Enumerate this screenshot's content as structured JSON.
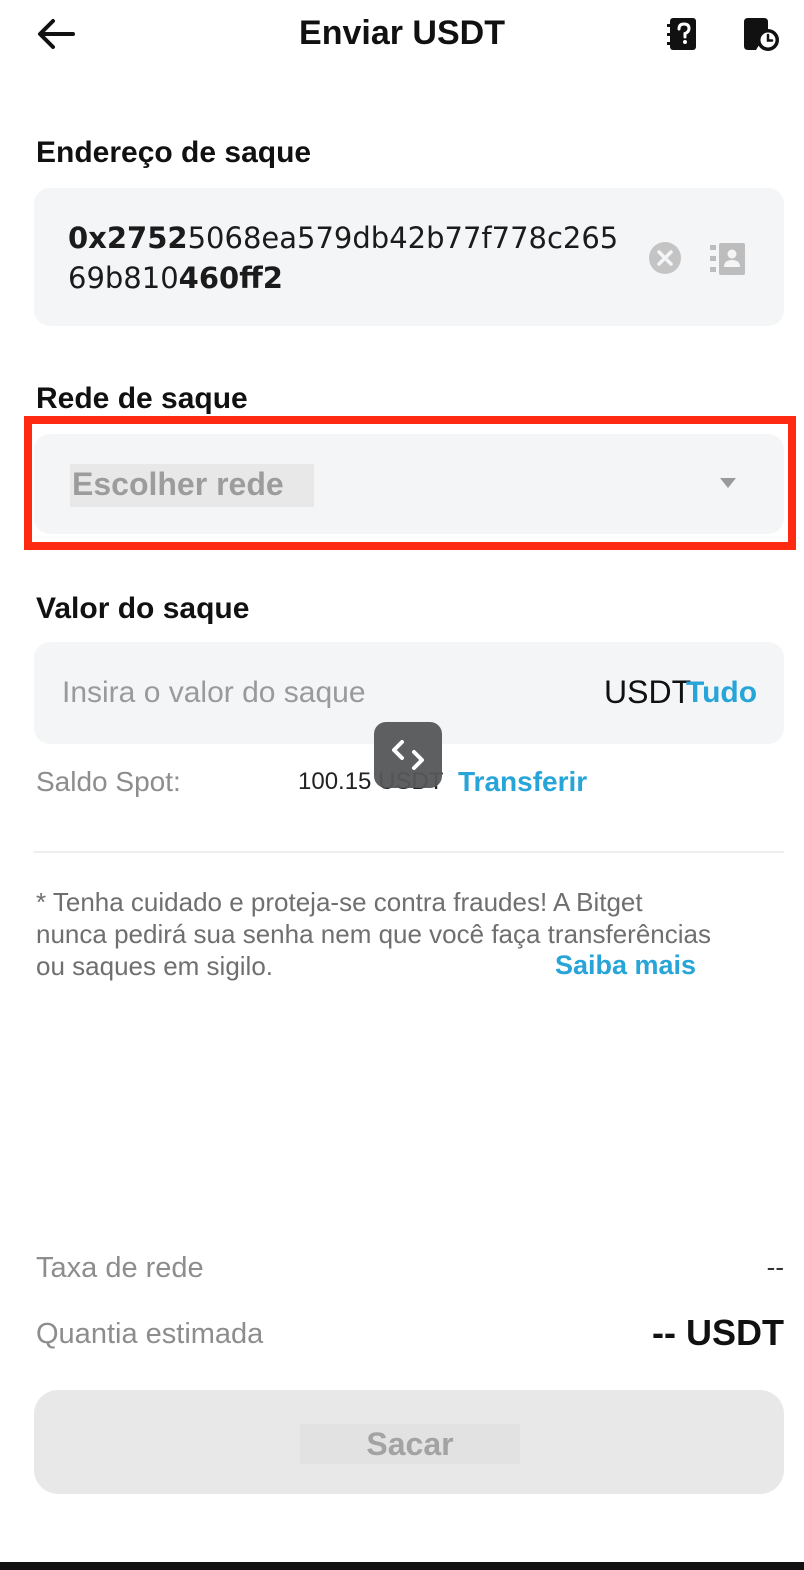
{
  "header": {
    "title": "Enviar USDT",
    "back_icon": "arrow-left-icon",
    "help_icon": "help-book-icon",
    "history_icon": "history-icon"
  },
  "address": {
    "label": "Endereço de saque",
    "value": "0x27525068ea579db42b77f778c26569b810460ff2",
    "value_line1_bold": "0x2752",
    "value_line1_rest": "5068ea579db42b77f778c265",
    "value_line2_rest": "69b810",
    "value_line2_bold": "460ff2",
    "clear_icon": "clear-circle-icon",
    "contacts_icon": "address-book-icon"
  },
  "network": {
    "label": "Rede de saque",
    "placeholder": "Escolher rede",
    "dropdown_icon": "caret-down-icon",
    "highlight_color": "#ff2a12"
  },
  "amount": {
    "label": "Valor do saque",
    "placeholder": "Insira o valor do saque",
    "value": "",
    "unit": "USDT",
    "all_label": "Tudo",
    "balance_label": "Saldo Spot:",
    "balance_value": "100.15 USDT",
    "transfer_label": "Transferir",
    "swap_icon": "swap-arrows-icon"
  },
  "warning": {
    "text": "* Tenha cuidado e proteja-se contra fraudes! A Bitget nunca pedirá sua senha nem que você faça transferências ou saques em sigilo.",
    "learn_more_label": "Saiba mais"
  },
  "summary": {
    "fee_label": "Taxa de rede",
    "fee_value": "--",
    "estimate_label": "Quantia estimada",
    "estimate_value": "-- USDT"
  },
  "submit": {
    "label": "Sacar"
  },
  "colors": {
    "accent": "#27a4d8",
    "field_bg": "#f4f5f6",
    "highlight": "#ff2a12",
    "disabled_button": "#e8e8e8"
  }
}
